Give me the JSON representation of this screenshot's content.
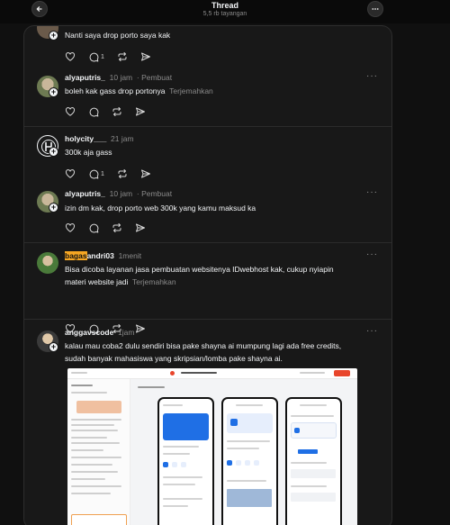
{
  "header": {
    "title": "Thread",
    "subtitle": "5,5 rb tayangan"
  },
  "posts": [
    {
      "username": "",
      "text": "Nanti saya drop porto saya kak",
      "translate": "",
      "reply_count": "1"
    },
    {
      "username": "alyaputris_",
      "time": "10 jam",
      "author_tag": "· Pembuat",
      "text": "boleh kak gass drop portonya",
      "translate": "Terjemahkan",
      "reply_count": ""
    },
    {
      "username": "holycity___",
      "time": "21 jam",
      "author_tag": "",
      "text": "300k aja gass",
      "translate": "",
      "reply_count": "1"
    },
    {
      "username": "alyaputris_",
      "time": "10 jam",
      "author_tag": "· Pembuat",
      "text": "izin dm kak, drop porto web 300k yang kamu maksud ka",
      "translate": "",
      "reply_count": ""
    },
    {
      "username_highlight": "bagas",
      "username_rest": "andri03",
      "time": "1menit",
      "author_tag": "",
      "text_line1": "Bisa dicoba layanan jasa pembuatan websitenya IDwebhost kak, cukup nyiapin",
      "text_line2": "materi website jadi",
      "translate": "Terjemahkan",
      "reply_count": ""
    },
    {
      "username": "anggavscode",
      "time": "1jam",
      "author_tag": "",
      "text_line1": "kalau mau coba2 dulu sendiri bisa pake shayna ai mumpung lagi ada free credits,",
      "text_line2": "sudah banyak mahasiswa yang skripsian/lomba pake shayna ai.",
      "reply_count": ""
    }
  ],
  "icons": {
    "back": "arrow-left-icon",
    "more": "more-horizontal-icon",
    "like": "heart-icon",
    "reply": "comment-icon",
    "repost": "repost-icon",
    "share": "send-icon",
    "follow": "plus-icon"
  },
  "colors": {
    "background": "#101010",
    "panel": "#181818",
    "highlight": "#f5a623",
    "muted": "#8a8a8a"
  }
}
